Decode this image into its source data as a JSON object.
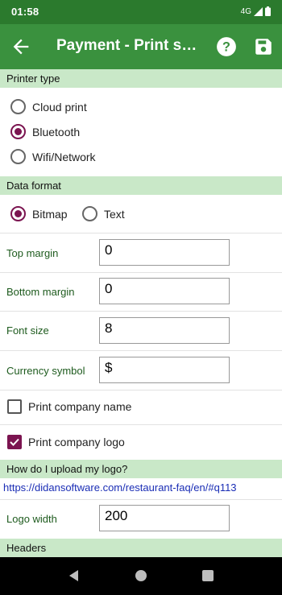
{
  "status_bar": {
    "time": "01:58",
    "network": "4G"
  },
  "app_bar": {
    "title": "Payment - Print settings"
  },
  "sections": {
    "printer_type": "Printer type",
    "data_format": "Data format",
    "upload_logo": "How do I upload my logo?",
    "headers": "Headers"
  },
  "printer_type": {
    "options": [
      {
        "label": "Cloud print",
        "selected": false
      },
      {
        "label": "Bluetooth",
        "selected": true
      },
      {
        "label": "Wifi/Network",
        "selected": false
      }
    ]
  },
  "data_format": {
    "options": [
      {
        "label": "Bitmap",
        "selected": true
      },
      {
        "label": "Text",
        "selected": false
      }
    ]
  },
  "fields": {
    "top_margin": {
      "label": "Top margin",
      "value": "0"
    },
    "bottom_margin": {
      "label": "Bottom margin",
      "value": "0"
    },
    "font_size": {
      "label": "Font size",
      "value": "8"
    },
    "currency_symbol": {
      "label": "Currency symbol",
      "value": "$"
    },
    "logo_width": {
      "label": "Logo width",
      "value": "200"
    }
  },
  "checkboxes": {
    "print_company_name": {
      "label": "Print company name",
      "checked": false
    },
    "print_company_logo": {
      "label": "Print company logo",
      "checked": true
    }
  },
  "logo_help_link": "https://didansoftware.com/restaurant-faq/en/#q113",
  "colors": {
    "status_bar": "#2b7a2d",
    "app_bar": "#3a913e",
    "section_bg": "#c9e8c8",
    "accent": "#7b1450",
    "label": "#1e5b1e",
    "link": "#1a2db5"
  }
}
